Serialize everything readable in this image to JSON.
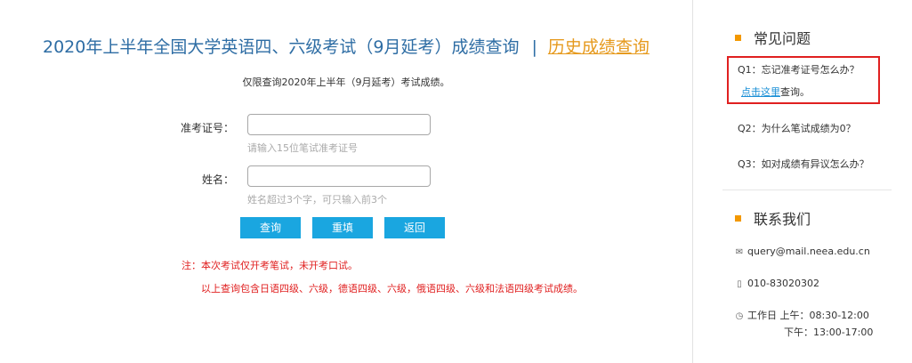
{
  "main": {
    "title": "2020年上半年全国大学英语四、六级考试（9月延考）成绩查询",
    "separator": "|",
    "history_link": "历史成绩查询",
    "subnote": "仅限查询2020年上半年（9月延考）考试成绩。",
    "form": {
      "ticket_label": "准考证号：",
      "ticket_value": "",
      "ticket_hint": "请输入15位笔试准考证号",
      "name_label": "姓名：",
      "name_value": "",
      "name_hint": "姓名超过3个字，可只输入前3个"
    },
    "buttons": {
      "query": "查询",
      "reset": "重填",
      "back": "返回"
    },
    "notes": {
      "note1": "注：本次考试仅开考笔试，未开考口试。",
      "note2": "以上查询包含日语四级、六级，德语四级、六级，俄语四级、六级和法语四级考试成绩。"
    }
  },
  "sidebar": {
    "faq_title": "常见问题",
    "faq": [
      {
        "q": "Q1：忘记准考证号怎么办？",
        "link": "点击这里",
        "after": "查询。"
      },
      {
        "q": "Q2：为什么笔试成绩为0？"
      },
      {
        "q": "Q3：如对成绩有异议怎么办？"
      }
    ],
    "contact_title": "联系我们",
    "contact": {
      "email": "query@mail.neea.edu.cn",
      "phone": "010-83020302",
      "hours_am": "工作日 上午：08:30-12:00",
      "hours_pm": "下午：13:00-17:00"
    }
  },
  "icons": {
    "email": "envelope-icon",
    "phone": "phone-icon",
    "clock": "clock-icon"
  },
  "colors": {
    "title": "#2e6da4",
    "history_link": "#e69a1e",
    "button": "#1aa6e0",
    "note": "#e02020",
    "bullet": "#f39800",
    "link": "#1a8fd6"
  }
}
